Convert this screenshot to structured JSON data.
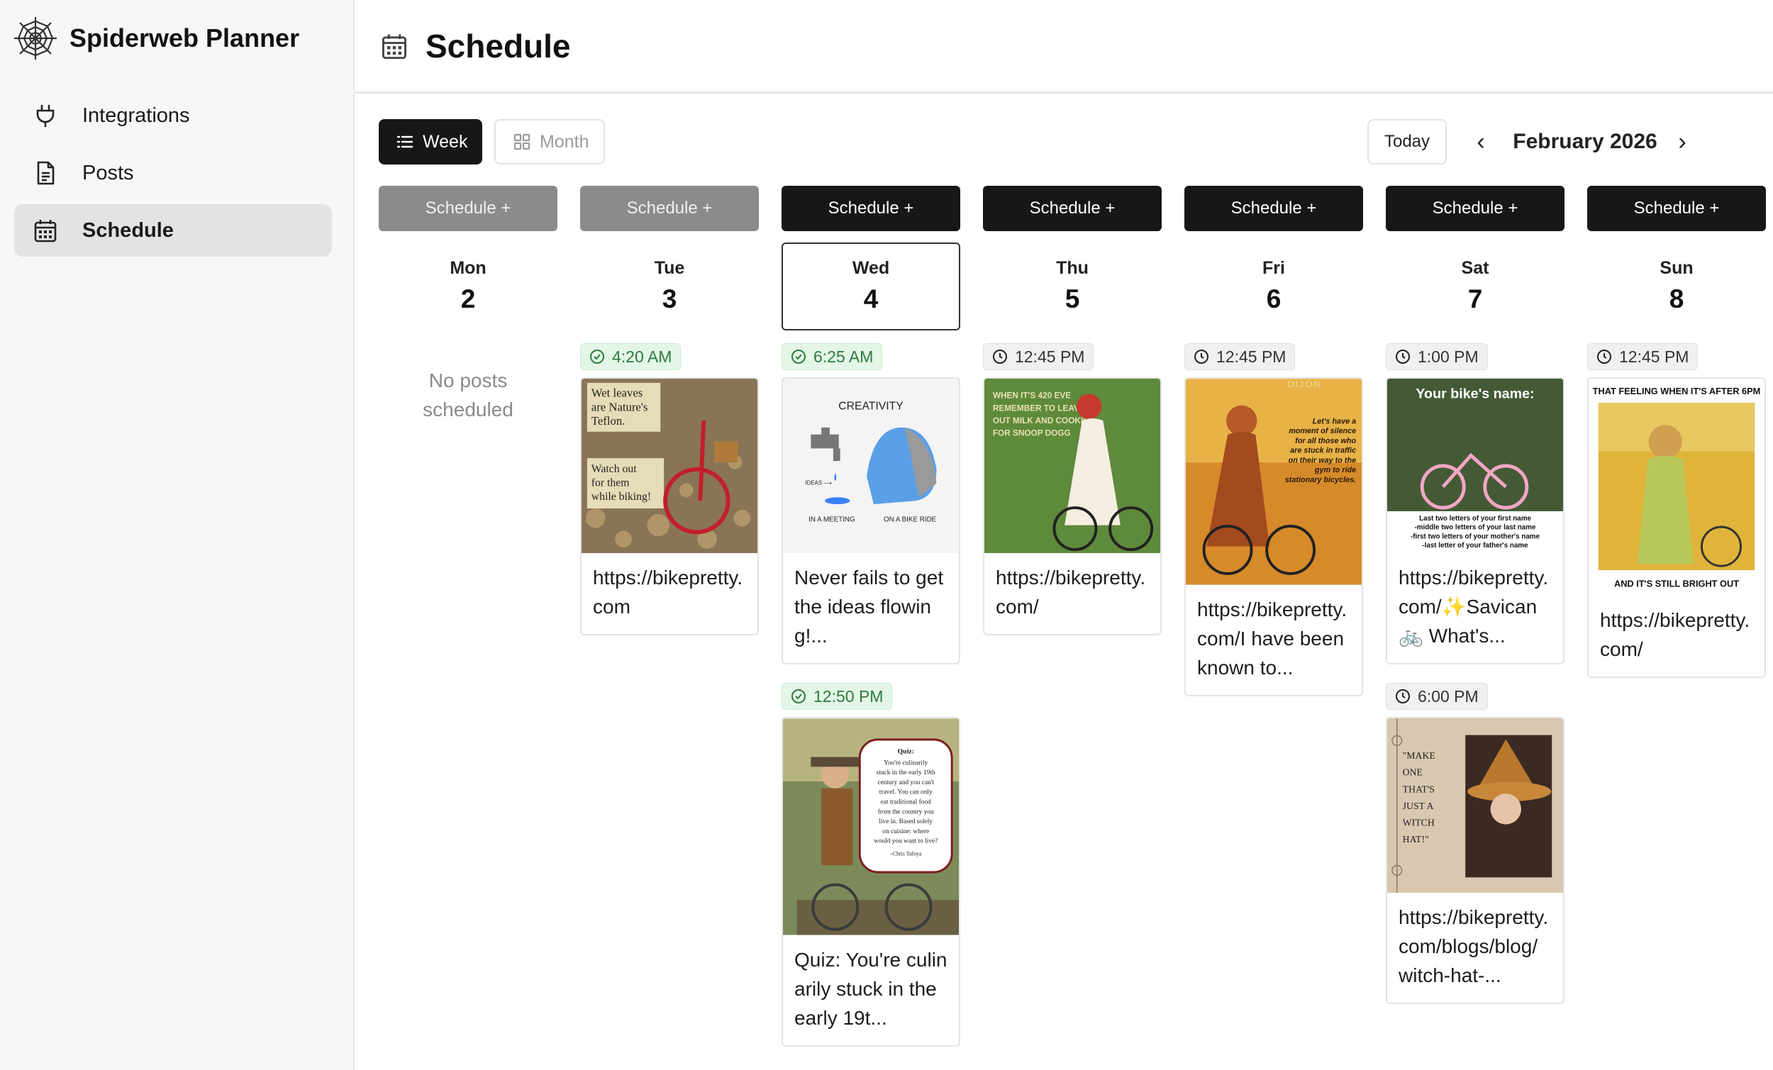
{
  "app": {
    "name": "Spiderweb Planner"
  },
  "sidebar": {
    "items": [
      {
        "label": "Integrations",
        "icon": "plug-icon"
      },
      {
        "label": "Posts",
        "icon": "document-icon"
      },
      {
        "label": "Schedule",
        "icon": "calendar-icon",
        "active": true
      }
    ]
  },
  "header": {
    "title": "Schedule",
    "icon": "calendar-icon"
  },
  "toolbar": {
    "week_label": "Week",
    "month_label": "Month",
    "today_label": "Today",
    "prev_symbol": "‹",
    "next_symbol": "›",
    "current_month": "February 2026"
  },
  "schedule_button_label": "Schedule +",
  "days": [
    {
      "name": "Mon",
      "num": "2",
      "empty_text": "No posts scheduled"
    },
    {
      "name": "Tue",
      "num": "3"
    },
    {
      "name": "Wed",
      "num": "4",
      "today": true
    },
    {
      "name": "Thu",
      "num": "5"
    },
    {
      "name": "Fri",
      "num": "6"
    },
    {
      "name": "Sat",
      "num": "7"
    },
    {
      "name": "Sun",
      "num": "8"
    }
  ],
  "posts": {
    "tue": [
      {
        "time": "4:20 AM",
        "status": "published",
        "caption": "https://bikepretty.com",
        "image_text": {
          "top": "Wet leaves are Nature's Teflon.",
          "bottom": "Watch out for them while biking!"
        }
      }
    ],
    "wed": [
      {
        "time": "6:25 AM",
        "status": "published",
        "caption": "Never fails to get the ideas flowing!...",
        "image_text": {
          "title": "CREATIVITY",
          "ideas": "IDEAS",
          "left": "IN A MEETING",
          "right": "ON A BIKE RIDE"
        }
      },
      {
        "time": "12:50 PM",
        "status": "published",
        "caption": "Quiz: You're culinarily stuck in the early 19t...",
        "image_text": {
          "quote": "Quiz: You're culinarily stuck in the early 19th century and you can't travel. You can only eat traditional food from the country you live in. Based solely on cuisine: where would you want to live?",
          "author": "–Chris Tafoya"
        }
      }
    ],
    "thu": [
      {
        "time": "12:45 PM",
        "status": "scheduled",
        "caption": "https://bikepretty.com/",
        "image_text": {
          "top": "WHEN IT'S 420 EVE REMEMBER TO LEAVE OUT MILK AND COOKIES FOR SNOOP DOGG"
        }
      }
    ],
    "fri": [
      {
        "time": "12:45 PM",
        "status": "scheduled",
        "caption": "https://bikepretty.com/I have been known to...",
        "image_text": {
          "top": "DIJON",
          "body": "Let's have a moment of silence for all those who are stuck in traffic on their way to the gym to ride stationary bicycles."
        }
      }
    ],
    "sat": [
      {
        "time": "1:00 PM",
        "status": "scheduled",
        "caption": "https://bikepretty.com/✨Savican 🚲 What's...",
        "image_text": {
          "top": "Your bike's name:",
          "bottom": "Last two letters of your first name -middle two letters of your last name -first two letters of your mother's name -last letter of your father's name"
        }
      },
      {
        "time": "6:00 PM",
        "status": "scheduled",
        "caption": "https://bikepretty.com/blogs/blog/witch-hat-...",
        "image_text": {
          "quote": "\"MAKE ONE THAT'S JUST A WITCH HAT!\""
        }
      }
    ],
    "sun": [
      {
        "time": "12:45 PM",
        "status": "scheduled",
        "caption": "https://bikepretty.com/",
        "image_text": {
          "top": "THAT FEELING WHEN IT'S AFTER 6PM",
          "bottom": "AND IT'S STILL BRIGHT OUT"
        }
      }
    ]
  }
}
